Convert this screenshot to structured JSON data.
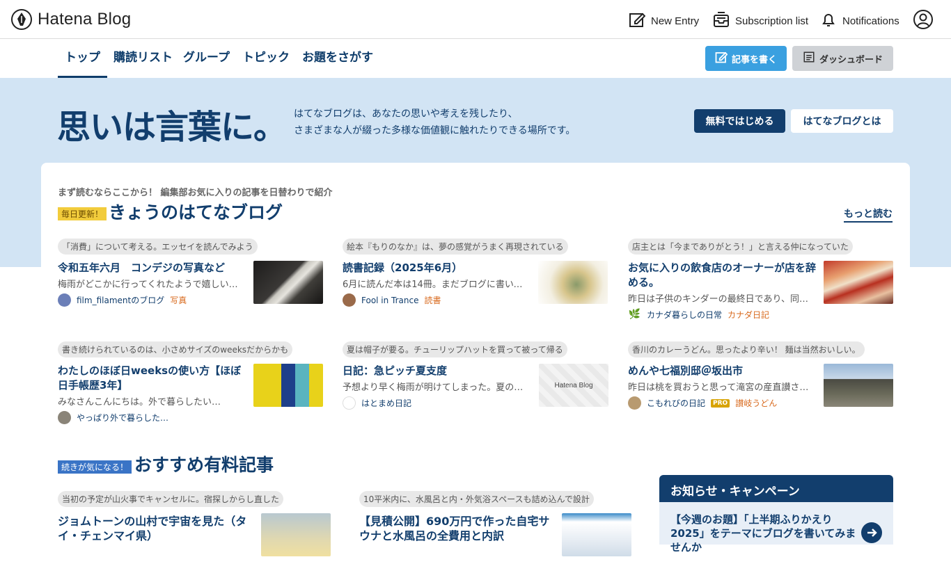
{
  "header": {
    "logo_text": "Hatena Blog",
    "new_entry": "New Entry",
    "subscription_list": "Subscription list",
    "notifications": "Notifications"
  },
  "nav": {
    "tabs": [
      {
        "label": "トップ",
        "active": true
      },
      {
        "label": "購読リスト",
        "active": false
      },
      {
        "label": "グループ",
        "active": false
      },
      {
        "label": "トピック",
        "active": false
      },
      {
        "label": "お題をさがす",
        "active": false
      }
    ],
    "write_button": "記事を書く",
    "dashboard_button": "ダッシュボード"
  },
  "hero": {
    "title": "思いは言葉に。",
    "desc_line1": "はてなブログは、あなたの思いや考えを残したり、",
    "desc_line2": "さまざまな人が綴った多様な価値観に触れたりできる場所です。",
    "start_button": "無料ではじめる",
    "about_button": "はてなブログとは"
  },
  "today": {
    "subtitle": "まず読むならここから！ 編集部お気に入りの記事を日替わりで紹介",
    "badge": "毎日更新！",
    "title": "きょうのはてなブログ",
    "more": "もっと読む",
    "entries": [
      {
        "tag": "「消費」について考える。エッセイを読んでみよう",
        "title": "令和五年六月　コンデジの写真など",
        "excerpt": "梅雨がどこかに行ってくれたようで嬉しい…",
        "blog": "film_filamentのブログ",
        "category": "写真",
        "pro": false
      },
      {
        "tag": "絵本『もりのなか』は、夢の感覚がうまく再現されている",
        "title": "読書記録（2025年6月）",
        "excerpt": "6月に読んだ本は14冊。まだブログに書いて…",
        "blog": "Fool in Trance",
        "category": "読書",
        "pro": false
      },
      {
        "tag": "店主とは「今までありがとう！」と言える仲になっていた",
        "title": "お気に入りの飲食店のオーナーが店を辞める。",
        "excerpt": "昨日は子供のキンダーの最終日であり、同…",
        "blog": "カナダ暮らしの日常",
        "category": "カナダ日記",
        "pro": false
      },
      {
        "tag": "書き続けられているのは、小さめサイズのweeksだからかも",
        "title": "わたしのほぼ日weeksの使い方【ほぼ日手帳歴3年】",
        "excerpt": "みなさんこんにちは。外で暮らしたい…",
        "blog": "やっぱり外で暮らした…",
        "category": "",
        "pro": false
      },
      {
        "tag": "夏は帽子が要る。チューリップハットを買って被って帰る",
        "title": "日記：急ピッチ夏支度",
        "excerpt": "予想より早く梅雨が明けてしまった。夏の…",
        "blog": "はとまめ日記",
        "category": "",
        "pro": false
      },
      {
        "tag": "香川のカレーうどん。思ったより辛い！ 麺は当然おいしい。",
        "title": "めんや七福別邸＠坂出市",
        "excerpt": "昨日は桃を買おうと思って滝宮の産直讃さ…",
        "blog": "こもれびの日記",
        "category": "讃岐うどん",
        "pro": true,
        "pro_label": "PRO"
      }
    ],
    "placeholder_thumb": "Hatena Blog"
  },
  "paid": {
    "badge": "続きが気になる！",
    "title": "おすすめ有料記事",
    "entries": [
      {
        "tag": "当初の予定が山火事でキャンセルに。宿探しからし直した",
        "title": "ジョムトーンの山村で宇宙を見た（タイ・チェンマイ県）"
      },
      {
        "tag": "10平米内に、水風呂と内・外気浴スペースも詰め込んで設計",
        "title": "【見積公開】690万円で作った自宅サウナと水風呂の全費用と内訳"
      }
    ]
  },
  "notice": {
    "title": "お知らせ・キャンペーン",
    "text": "【今週のお題】「上半期ふりかえり2025」をテーマにブログを書いてみませんか"
  }
}
